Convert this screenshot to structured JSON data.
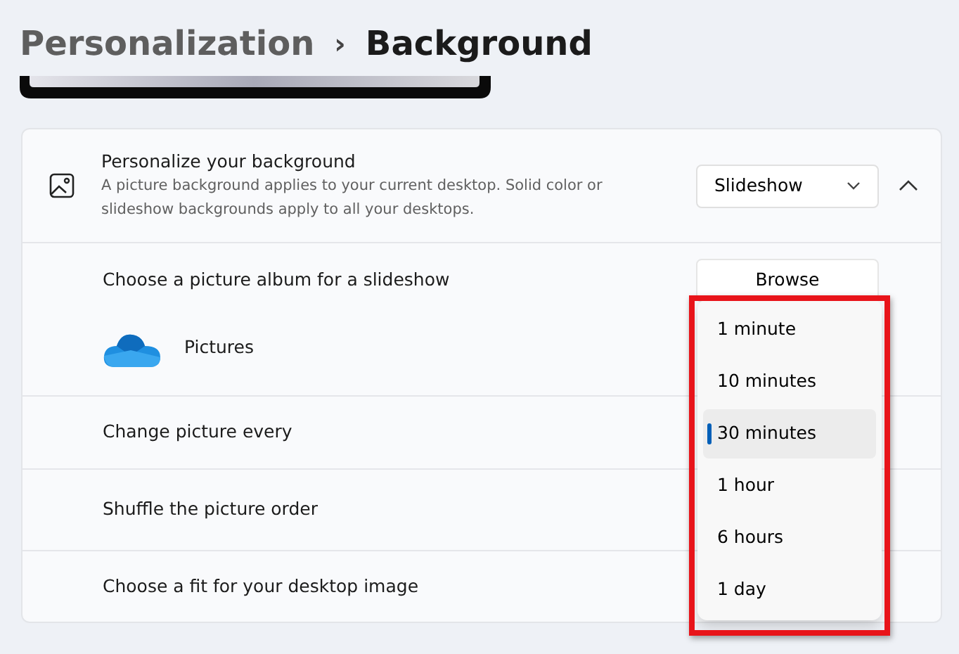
{
  "breadcrumb": {
    "parent": "Personalization",
    "separator": "›",
    "current": "Background"
  },
  "background_card": {
    "title": "Personalize your background",
    "description": "A picture background applies to your current desktop. Solid color or slideshow backgrounds apply to all your desktops.",
    "dropdown_value": "Slideshow",
    "expanded": true
  },
  "rows": [
    {
      "kind": "album",
      "label": "Choose a picture album for a slideshow",
      "button": "Browse",
      "album": "Pictures"
    },
    {
      "kind": "plain",
      "label": "Change picture every"
    },
    {
      "kind": "plain",
      "label": "Shuffle the picture order"
    },
    {
      "kind": "plain",
      "label": "Choose a fit for your desktop image"
    }
  ],
  "interval_menu": [
    {
      "label": "1 minute",
      "selected": false
    },
    {
      "label": "10 minutes",
      "selected": false
    },
    {
      "label": "30 minutes",
      "selected": true
    },
    {
      "label": "1 hour",
      "selected": false
    },
    {
      "label": "6 hours",
      "selected": false
    },
    {
      "label": "1 day",
      "selected": false
    }
  ]
}
